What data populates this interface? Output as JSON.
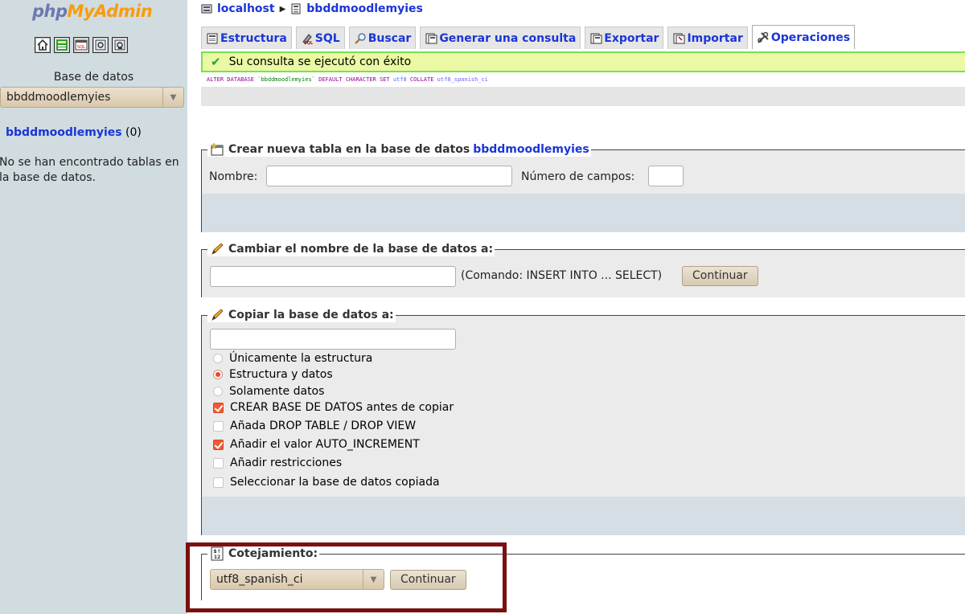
{
  "app": {
    "logo_php": "php",
    "logo_my": "My",
    "logo_admin": "Admin"
  },
  "nav": {
    "quick_icons": [
      "home-icon",
      "exit-icon",
      "sql-query-icon",
      "docs-icon",
      "mysql-docs-icon"
    ],
    "db_label": "Base de datos",
    "db_selected": "bbddmoodlemyies",
    "db_name": "bbddmoodlemyies",
    "db_count": "(0)",
    "no_tables": "No se han encontrado tablas en la base de datos."
  },
  "breadcrumb": {
    "server": "localhost",
    "database": "bbddmoodlemyies"
  },
  "tabs": [
    {
      "label": "Estructura",
      "icon": "structure-icon"
    },
    {
      "label": "SQL",
      "icon": "sql-icon"
    },
    {
      "label": "Buscar",
      "icon": "search-icon"
    },
    {
      "label": "Generar una consulta",
      "icon": "query-icon"
    },
    {
      "label": "Exportar",
      "icon": "export-icon"
    },
    {
      "label": "Importar",
      "icon": "import-icon"
    },
    {
      "label": "Operaciones",
      "icon": "operations-icon",
      "active": true
    }
  ],
  "success": {
    "message": "Su consulta se ejecutó con éxito"
  },
  "sql": {
    "alter": "ALTER DATABASE",
    "db": "`bbddmoodlemyies`",
    "default_cs": "DEFAULT CHARACTER SET",
    "cs": "utf8",
    "collate": "COLLATE",
    "collation": "utf8_spanish_ci"
  },
  "create_table": {
    "legend_prefix": "Crear nueva tabla en la base de datos",
    "legend_db": "bbddmoodlemyies",
    "name_label": "Nombre:",
    "name_value": "",
    "fields_label": "Número de campos:",
    "fields_value": ""
  },
  "rename": {
    "legend": "Cambiar el nombre de la base de datos a:",
    "value": "",
    "command": "(Comando: INSERT INTO ... SELECT)",
    "button": "Continuar"
  },
  "copy": {
    "legend": "Copiar la base de datos a:",
    "value": "",
    "radios": [
      {
        "label": "Únicamente la estructura",
        "checked": false
      },
      {
        "label": "Estructura y datos",
        "checked": true
      },
      {
        "label": "Solamente datos",
        "checked": false
      }
    ],
    "checks": [
      {
        "label": "CREAR BASE DE DATOS antes de copiar",
        "checked": true
      },
      {
        "label": "Añada DROP TABLE / DROP VIEW",
        "checked": false
      },
      {
        "label": "Añadir el valor AUTO_INCREMENT",
        "checked": true
      },
      {
        "label": "Añadir restricciones",
        "checked": false
      },
      {
        "label": "Seleccionar la base de datos copiada",
        "checked": false
      }
    ]
  },
  "collation": {
    "legend": "Cotejamiento:",
    "selected": "utf8_spanish_ci",
    "button": "Continuar"
  },
  "colors": {
    "link": "#1b35d6",
    "highlight_border": "#7b1010",
    "success_border": "#7ae04f"
  }
}
